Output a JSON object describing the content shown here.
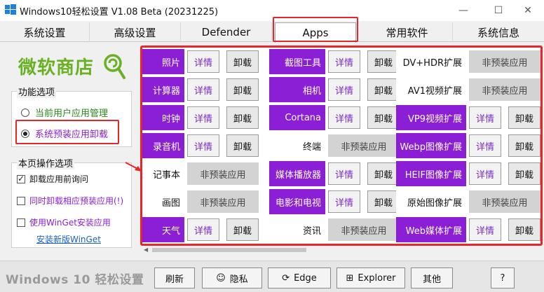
{
  "window": {
    "title": "Windows10轻松设置 V1.08 Beta (20231225)",
    "minimize": "—",
    "maximize": "☐",
    "close": "✕"
  },
  "tabs": [
    {
      "label": "系统设置"
    },
    {
      "label": "高级设置"
    },
    {
      "label": "Defender"
    },
    {
      "label": "Apps"
    },
    {
      "label": "常用软件"
    },
    {
      "label": "系统信息"
    }
  ],
  "left": {
    "logo_text": "微软商店",
    "function_group": {
      "title": "功能选项",
      "options": [
        {
          "label": "当前用户应用管理",
          "selected": false
        },
        {
          "label": "系统预装应用卸载",
          "selected": true
        }
      ]
    },
    "page_group": {
      "title": "本页操作选项",
      "options": [
        {
          "label": "卸载应用前询问",
          "checked": true
        },
        {
          "label": "同时卸载相应预装应用(!)",
          "checked": false
        },
        {
          "label": "使用WinGet安装应用",
          "checked": false
        }
      ],
      "link": "安装新版WinGet"
    }
  },
  "apps": {
    "detail_label": "详情",
    "uninstall_label": "卸载",
    "not_preinstalled_label": "非预装应用",
    "columns": [
      [
        {
          "name": "照片",
          "installed": true
        },
        {
          "name": "计算器",
          "installed": true
        },
        {
          "name": "时钟",
          "installed": true
        },
        {
          "name": "录音机",
          "installed": true
        },
        {
          "name": "记事本",
          "installed": false
        },
        {
          "name": "画图",
          "installed": false
        },
        {
          "name": "天气",
          "installed": true
        }
      ],
      [
        {
          "name": "截图工具",
          "installed": true
        },
        {
          "name": "相机",
          "installed": true
        },
        {
          "name": "Cortana",
          "installed": true
        },
        {
          "name": "终端",
          "installed": false
        },
        {
          "name": "媒体播放器",
          "installed": true
        },
        {
          "name": "电影和电视",
          "installed": true
        },
        {
          "name": "资讯",
          "installed": false
        }
      ],
      [
        {
          "name": "DV+HDR扩展",
          "installed": false
        },
        {
          "name": "AV1视频扩展",
          "installed": false
        },
        {
          "name": "VP9视频扩展",
          "installed": true
        },
        {
          "name": "Webp图像扩展",
          "installed": true
        },
        {
          "name": "HEIF图像扩展",
          "installed": true
        },
        {
          "name": "原始图像扩展",
          "installed": false
        },
        {
          "name": "Web媒体扩展",
          "installed": true
        }
      ]
    ]
  },
  "bottom": {
    "brand": "Windows 10 轻松设置",
    "buttons": [
      {
        "label": "刷新",
        "icon": ""
      },
      {
        "label": "隐私",
        "icon": "☺"
      },
      {
        "label": "Edge",
        "icon": "⟳"
      },
      {
        "label": "Explorer",
        "icon": "⊞"
      },
      {
        "label": "其他",
        "icon": ""
      },
      {
        "label": "?",
        "icon": ""
      }
    ]
  },
  "colors": {
    "accent_purple": "#8a1fd6",
    "highlight_red": "#e5262a",
    "logo_green": "#6ab023",
    "link_blue": "#1a5fc8"
  }
}
